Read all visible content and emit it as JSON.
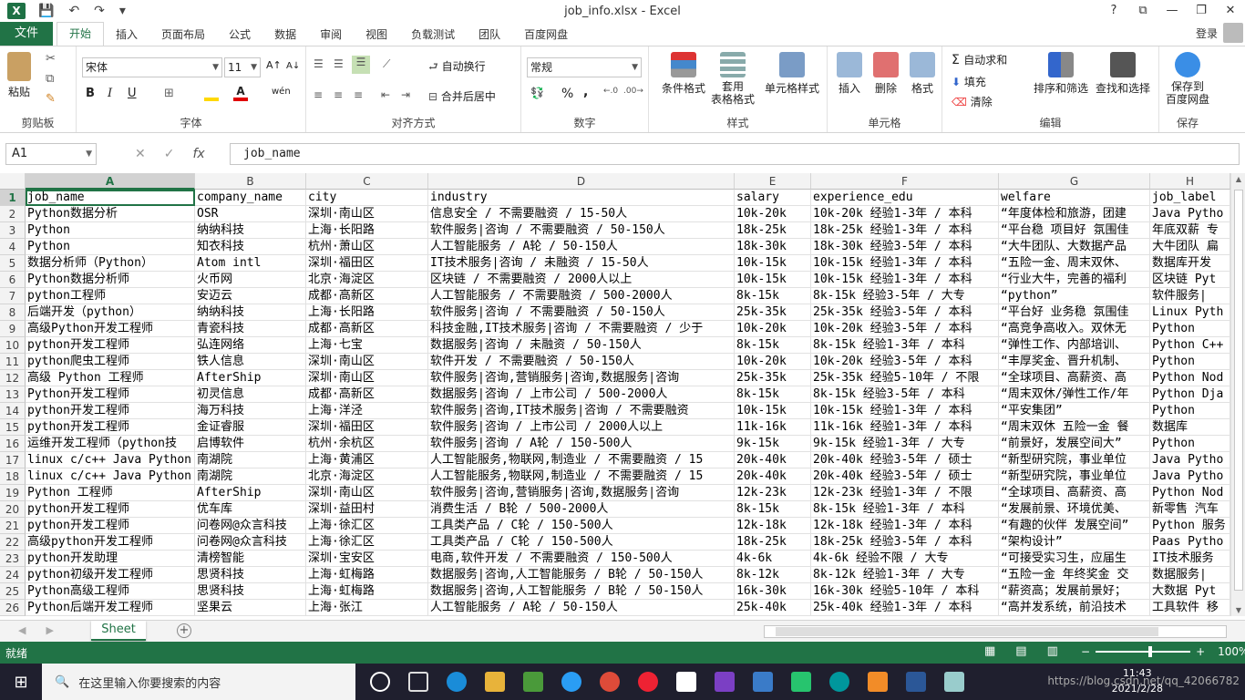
{
  "window": {
    "title": "job_info.xlsx - Excel",
    "help": "?",
    "controls": [
      "⧉",
      "—",
      "❐",
      "✕"
    ]
  },
  "quick_access": {
    "save": "💾",
    "undo": "↶",
    "redo": "↷",
    "customize": "▾"
  },
  "menu": {
    "file": "文件",
    "tabs": [
      "开始",
      "插入",
      "页面布局",
      "公式",
      "数据",
      "审阅",
      "视图",
      "负载测试",
      "团队",
      "百度网盘"
    ],
    "active_tab": "开始",
    "login": "登录"
  },
  "ribbon": {
    "clipboard": {
      "paste": "粘贴",
      "label": "剪贴板"
    },
    "font": {
      "name": "宋体",
      "size": "11",
      "label": "字体",
      "bold": "B",
      "italic": "I",
      "underline": "U",
      "grow": "A↑",
      "shrink": "A↓",
      "wen": "wén"
    },
    "alignment": {
      "wrap": "自动换行",
      "merge": "合并后居中",
      "label": "对齐方式"
    },
    "number": {
      "format": "常规",
      "label": "数字",
      "percent": "%",
      "comma": ","
    },
    "styles": {
      "conditional": "条件格式",
      "table": "套用\n表格格式",
      "cell_styles": "单元格样式",
      "label": "样式"
    },
    "cells": {
      "insert": "插入",
      "delete": "删除",
      "format": "格式",
      "label": "单元格"
    },
    "editing": {
      "autosum": "自动求和",
      "fill": "填充",
      "clear": "清除",
      "sort": "排序和筛选",
      "find": "查找和选择",
      "label": "编辑"
    },
    "save": {
      "save_baidu": "保存到\n百度网盘",
      "label": "保存"
    }
  },
  "formula_bar": {
    "name_box": "A1",
    "fx": "fx",
    "value": "job_name",
    "cancel": "✕",
    "enter": "✓"
  },
  "columns": [
    "A",
    "B",
    "C",
    "D",
    "E",
    "F",
    "G",
    "H"
  ],
  "selected_column": "A",
  "rows": [
    {
      "n": "1",
      "cells": [
        "job_name",
        "company_name",
        "city",
        "industry",
        "salary",
        "experience_edu",
        "welfare",
        "job_label"
      ]
    },
    {
      "n": "2",
      "cells": [
        "Python数据分析",
        "OSR",
        "深圳·南山区",
        "信息安全 / 不需要融资 / 15-50人",
        "10k-20k",
        "10k-20k 经验1-3年 / 本科",
        "“年度体检和旅游，团建",
        "Java Pytho"
      ]
    },
    {
      "n": "3",
      "cells": [
        "Python",
        "纳纳科技",
        "上海·长阳路",
        "软件服务|咨询 / 不需要融资 / 50-150人",
        "18k-25k",
        "18k-25k 经验1-3年 / 本科",
        "“平台稳 项目好 氛围佳",
        "年底双薪 专"
      ]
    },
    {
      "n": "4",
      "cells": [
        "Python",
        "知衣科技",
        "杭州·萧山区",
        "人工智能服务 / A轮 / 50-150人",
        "18k-30k",
        "18k-30k 经验3-5年 / 本科",
        "“大牛团队、大数据产品",
        "大牛团队 扁"
      ]
    },
    {
      "n": "5",
      "cells": [
        "数据分析师（Python）",
        "Atom intl",
        "深圳·福田区",
        "IT技术服务|咨询 / 未融资 / 15-50人",
        "10k-15k",
        "10k-15k 经验1-3年 / 本科",
        "“五险一金、周末双休、",
        "数据库开发"
      ]
    },
    {
      "n": "6",
      "cells": [
        "Python数据分析师",
        "火币网",
        "北京·海淀区",
        "区块链 / 不需要融资 / 2000人以上",
        "10k-15k",
        "10k-15k 经验1-3年 / 本科",
        "“行业大牛，完善的福利",
        "区块链 Pyt"
      ]
    },
    {
      "n": "7",
      "cells": [
        "python工程师",
        "安迈云",
        "成都·高新区",
        "人工智能服务 / 不需要融资 / 500-2000人",
        "8k-15k",
        "8k-15k 经验3-5年 / 大专",
        "“python”",
        "软件服务|"
      ]
    },
    {
      "n": "8",
      "cells": [
        "后端开发（python）",
        "纳纳科技",
        "上海·长阳路",
        "软件服务|咨询 / 不需要融资 / 50-150人",
        "25k-35k",
        "25k-35k 经验3-5年 / 本科",
        "“平台好 业务稳 氛围佳",
        "Linux Pyth"
      ]
    },
    {
      "n": "9",
      "cells": [
        "高级Python开发工程师",
        "青瓷科技",
        "成都·高新区",
        "科技金融,IT技术服务|咨询 / 不需要融资 / 少于",
        "10k-20k",
        "10k-20k 经验3-5年 / 本科",
        "“高竞争高收入。双休无",
        "Python"
      ]
    },
    {
      "n": "10",
      "cells": [
        "python开发工程师",
        "弘连网络",
        "上海·七宝",
        "数据服务|咨询 / 未融资 / 50-150人",
        "8k-15k",
        "8k-15k 经验1-3年 / 本科",
        "“弹性工作、内部培训、",
        "Python C++"
      ]
    },
    {
      "n": "11",
      "cells": [
        "python爬虫工程师",
        "铁人信息",
        "深圳·南山区",
        "软件开发 / 不需要融资 / 50-150人",
        "10k-20k",
        "10k-20k 经验3-5年 / 本科",
        "“丰厚奖金、晋升机制、",
        "Python"
      ]
    },
    {
      "n": "12",
      "cells": [
        "高级 Python 工程师",
        "AfterShip",
        "深圳·南山区",
        "软件服务|咨询,营销服务|咨询,数据服务|咨询",
        "25k-35k",
        "25k-35k 经验5-10年 / 不限",
        "“全球项目、高薪资、高",
        "Python Nod"
      ]
    },
    {
      "n": "13",
      "cells": [
        "Python开发工程师",
        "初灵信息",
        "成都·高新区",
        "数据服务|咨询 / 上市公司 / 500-2000人",
        "8k-15k",
        "8k-15k 经验3-5年 / 本科",
        "“周末双休/弹性工作/年",
        "Python Dja"
      ]
    },
    {
      "n": "14",
      "cells": [
        "python开发工程师",
        "海万科技",
        "上海·洋泾",
        "软件服务|咨询,IT技术服务|咨询 / 不需要融资",
        "10k-15k",
        "10k-15k 经验1-3年 / 本科",
        "“平安集团”",
        "Python"
      ]
    },
    {
      "n": "15",
      "cells": [
        "python开发工程师",
        "金证睿服",
        "深圳·福田区",
        "软件服务|咨询 / 上市公司 / 2000人以上",
        "11k-16k",
        "11k-16k 经验1-3年 / 本科",
        "“周末双休 五险一金 餐",
        "数据库"
      ]
    },
    {
      "n": "16",
      "cells": [
        "运维开发工程师（python技",
        "启博软件",
        "杭州·余杭区",
        "软件服务|咨询 / A轮 / 150-500人",
        "9k-15k",
        "9k-15k 经验1-3年 / 大专",
        "“前景好，发展空间大”",
        "Python"
      ]
    },
    {
      "n": "17",
      "cells": [
        "linux c/c++ Java Python",
        "南湖院",
        "上海·黄浦区",
        "人工智能服务,物联网,制造业 / 不需要融资 / 15",
        "20k-40k",
        "20k-40k 经验3-5年 / 硕士",
        "“新型研究院，事业单位",
        "Java Pytho"
      ]
    },
    {
      "n": "18",
      "cells": [
        "linux c/c++ Java Python",
        "南湖院",
        "北京·海淀区",
        "人工智能服务,物联网,制造业 / 不需要融资 / 15",
        "20k-40k",
        "20k-40k 经验3-5年 / 硕士",
        "“新型研究院，事业单位",
        "Java Pytho"
      ]
    },
    {
      "n": "19",
      "cells": [
        "Python 工程师",
        "AfterShip",
        "深圳·南山区",
        "软件服务|咨询,营销服务|咨询,数据服务|咨询",
        "12k-23k",
        "12k-23k 经验1-3年 / 不限",
        "“全球项目、高薪资、高",
        "Python Nod"
      ]
    },
    {
      "n": "20",
      "cells": [
        "python开发工程师",
        "优车库",
        "深圳·益田村",
        "消费生活 / B轮 / 500-2000人",
        "8k-15k",
        "8k-15k 经验1-3年 / 本科",
        "“发展前景、环境优美、",
        "新零售 汽车"
      ]
    },
    {
      "n": "21",
      "cells": [
        "python开发工程师",
        "问卷网@众言科技",
        "上海·徐汇区",
        "工具类产品 / C轮 / 150-500人",
        "12k-18k",
        "12k-18k 经验1-3年 / 本科",
        "“有趣的伙伴 发展空间”",
        "Python 服务"
      ]
    },
    {
      "n": "22",
      "cells": [
        "高级python开发工程师",
        "问卷网@众言科技",
        "上海·徐汇区",
        "工具类产品 / C轮 / 150-500人",
        "18k-25k",
        "18k-25k 经验3-5年 / 本科",
        "“架构设计”",
        "Paas Pytho"
      ]
    },
    {
      "n": "23",
      "cells": [
        "python开发助理",
        "清榜智能",
        "深圳·宝安区",
        "电商,软件开发 / 不需要融资 / 150-500人",
        "4k-6k",
        "4k-6k 经验不限 / 大专",
        "“可接受实习生，应届生",
        "IT技术服务"
      ]
    },
    {
      "n": "24",
      "cells": [
        "python初级开发工程师",
        "思贤科技",
        "上海·虹梅路",
        "数据服务|咨询,人工智能服务 / B轮 / 50-150人",
        "8k-12k",
        "8k-12k 经验1-3年 / 大专",
        "“五险一金 年终奖金 交",
        "数据服务|"
      ]
    },
    {
      "n": "25",
      "cells": [
        "Python高级工程师",
        "思贤科技",
        "上海·虹梅路",
        "数据服务|咨询,人工智能服务 / B轮 / 50-150人",
        "16k-30k",
        "16k-30k 经验5-10年 / 本科",
        "“薪资高；发展前景好；",
        "大数据 Pyt"
      ]
    },
    {
      "n": "26",
      "cells": [
        "Python后端开发工程师",
        "坚果云",
        "上海·张江",
        "人工智能服务 / A轮 / 50-150人",
        "25k-40k",
        "25k-40k 经验1-3年 / 本科",
        "“高并发系统，前沿技术",
        "工具软件 移"
      ]
    }
  ],
  "sheets": {
    "tabs": [
      "Sheet"
    ],
    "add": "+"
  },
  "status": {
    "ready": "就绪",
    "zoom": "100%",
    "minus": "−",
    "plus": "+"
  },
  "taskbar": {
    "search_placeholder": "在这里输入你要搜索的内容",
    "time": "11:43",
    "date": "2021/2/28",
    "watermark": "https://blog.csdn.net/qq_42066782"
  },
  "colors": {
    "excel_green": "#217346",
    "taskbar": "#1f1f2e"
  }
}
